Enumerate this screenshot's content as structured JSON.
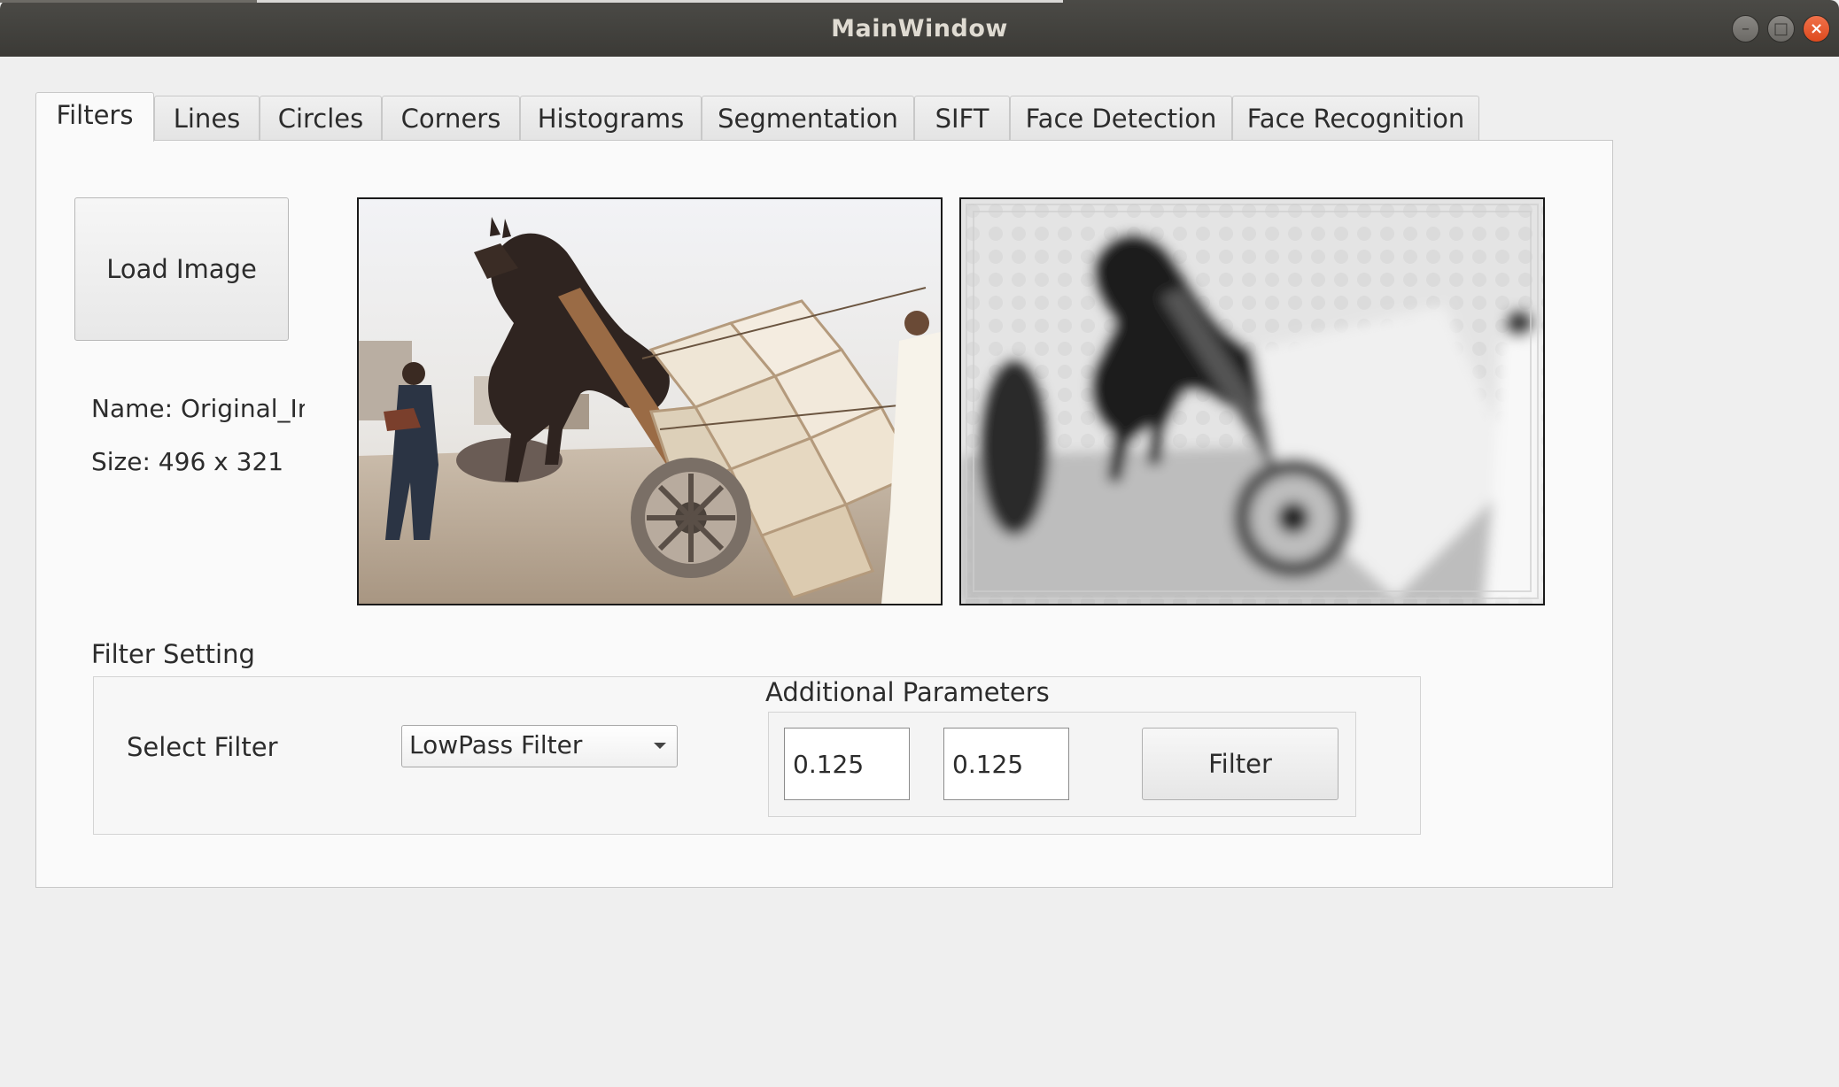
{
  "window": {
    "title": "MainWindow"
  },
  "tabs": [
    {
      "label": "Filters",
      "active": true
    },
    {
      "label": "Lines"
    },
    {
      "label": "Circles"
    },
    {
      "label": "Corners"
    },
    {
      "label": "Histograms"
    },
    {
      "label": "Segmentation"
    },
    {
      "label": "SIFT"
    },
    {
      "label": "Face Detection"
    },
    {
      "label": "Face Recognition"
    }
  ],
  "filters_tab": {
    "load_button": "Load Image",
    "image_name": "Name:  Original_Ir",
    "image_size": "Size: 496 x 321",
    "filter_setting_title": "Filter Setting",
    "select_filter_label": "Select Filter",
    "selected_filter": "LowPass Filter",
    "additional_parameters_title": "Additional Parameters",
    "param1_value": "0.125",
    "param2_value": "0.125",
    "filter_button": "Filter"
  },
  "images": {
    "original": "photo of a donkey rearing up while hitched to an overloaded cart",
    "filtered": "grayscale low-pass filtered version of the same photo"
  }
}
